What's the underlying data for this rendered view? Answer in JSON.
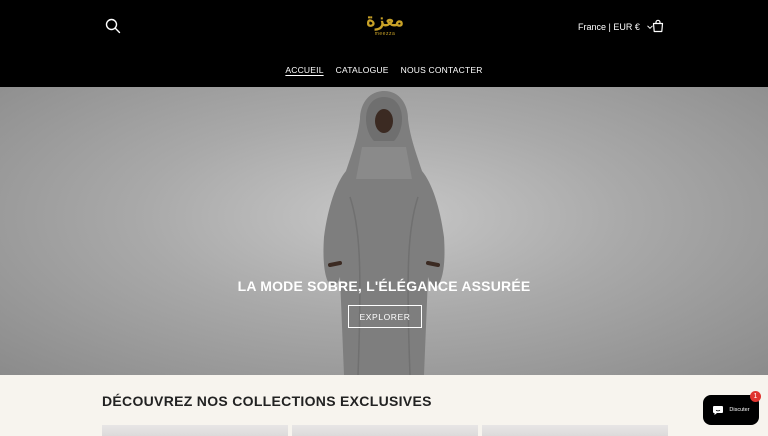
{
  "header": {
    "logo": {
      "arabic": "معزة",
      "latin": "meezza"
    },
    "locale_label": "France | EUR €",
    "icons": {
      "search": "search-icon",
      "cart": "cart-icon",
      "chevron": "chevron-down-icon"
    }
  },
  "nav": {
    "items": [
      {
        "label": "ACCUEIL",
        "active": true
      },
      {
        "label": "CATALOGUE",
        "active": false
      },
      {
        "label": "NOUS CONTACTER",
        "active": false
      }
    ]
  },
  "hero": {
    "title": "LA MODE SOBRE, L'ÉLÉGANCE ASSURÉE",
    "button_label": "EXPLORER"
  },
  "collections": {
    "title": "DÉCOUVREZ NOS COLLECTIONS EXCLUSIVES",
    "cards_visible": 3
  },
  "chat": {
    "label": "Discuter",
    "badge_count": "1"
  },
  "colors": {
    "header_bg": "#000000",
    "logo_gold": "#c9a227",
    "page_bg": "#f7f4ee",
    "badge_red": "#e0342f"
  }
}
